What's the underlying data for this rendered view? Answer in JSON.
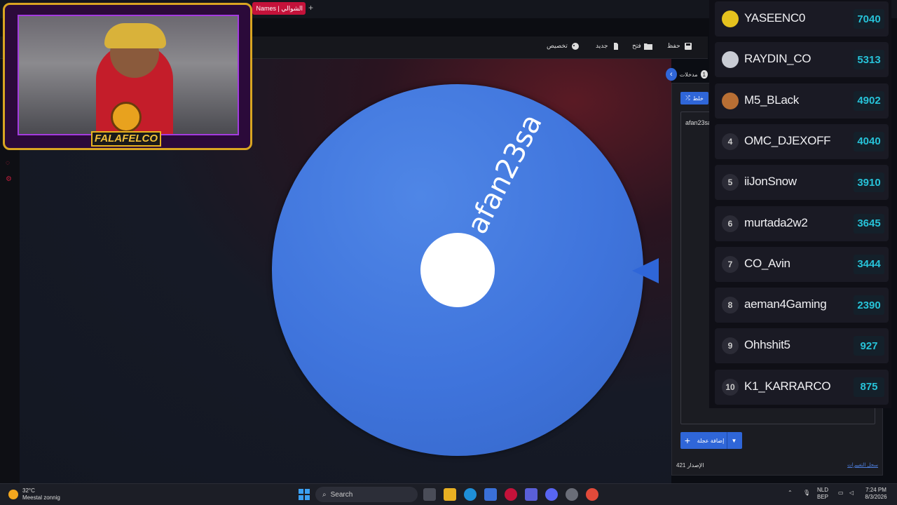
{
  "browser": {
    "active_tab_title": "الشوالي | Names",
    "new_tab_label": "+"
  },
  "app_toolbar": {
    "customize_label": "تخصيص",
    "new_label": "جديد",
    "open_label": "فتح",
    "save_label": "حفظ"
  },
  "wheel": {
    "segment_label": "afan23sa",
    "color": "#3f74dc"
  },
  "entries": {
    "tab_label": "مدخلات",
    "count": "1",
    "shuffle_label": "خلط",
    "entry_text": "afan23sa",
    "add_wheel_label": "إضافة عجلة",
    "version_label": "الإصدار",
    "version_number": "421",
    "changelog_label": "سجل التغييرات"
  },
  "leaderboard": [
    {
      "rank": "",
      "medal": "gold",
      "name": "YASEENC0",
      "score": "7040"
    },
    {
      "rank": "",
      "medal": "silver",
      "name": "RAYDIN_CO",
      "score": "5313"
    },
    {
      "rank": "",
      "medal": "bronze",
      "name": "M5_BLack",
      "score": "4902"
    },
    {
      "rank": "4",
      "medal": "",
      "name": "OMC_DJEXOFF",
      "score": "4040"
    },
    {
      "rank": "5",
      "medal": "",
      "name": "iiJonSnow",
      "score": "3910"
    },
    {
      "rank": "6",
      "medal": "",
      "name": "murtada2w2",
      "score": "3645"
    },
    {
      "rank": "7",
      "medal": "",
      "name": "CO_Avin",
      "score": "3444"
    },
    {
      "rank": "8",
      "medal": "",
      "name": "aeman4Gaming",
      "score": "2390"
    },
    {
      "rank": "9",
      "medal": "",
      "name": "Ohhshit5",
      "score": "927"
    },
    {
      "rank": "10",
      "medal": "",
      "name": "K1_KARRARCO",
      "score": "875"
    }
  ],
  "webcam": {
    "logo_text": "FALAFELCO"
  },
  "taskbar": {
    "temperature": "32°C",
    "weather_desc": "Meestal zonnig",
    "search_label": "Search",
    "lang_top": "NLD",
    "lang_bottom": "BEP",
    "time": "7:24 PM",
    "date": "8/3/2026"
  },
  "colors": {
    "accent": "#2f66d8",
    "tab_red": "#c4123a",
    "score_cyan": "#27c2d8"
  }
}
